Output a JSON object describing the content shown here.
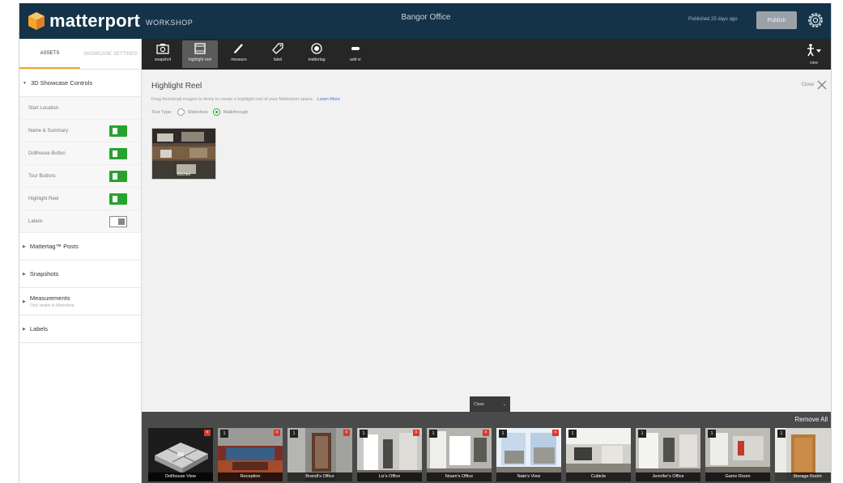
{
  "header": {
    "brand": "matterport",
    "product": "WORKSHOP",
    "space_title": "Bangor Office",
    "published": "Published 25 days ago",
    "publish_label": "Publish",
    "brand_colors": {
      "header_bg": "#143349",
      "toggle_on": "#27a32d",
      "accent": "#f6a623"
    }
  },
  "sidebar": {
    "tabs": [
      {
        "label": "ASSETS"
      },
      {
        "label": "SHOWCASE SETTINGS"
      }
    ],
    "controls_section": "3D Showcase Controls",
    "controls": [
      {
        "label": "Start Location",
        "toggle": null
      },
      {
        "label": "Name & Summary",
        "toggle": "on"
      },
      {
        "label": "Dollhouse Button",
        "toggle": "on"
      },
      {
        "label": "Tour Buttons",
        "toggle": "on"
      },
      {
        "label": "Highlight Reel",
        "toggle": "on"
      },
      {
        "label": "Labels",
        "toggle": "off"
      }
    ],
    "sections": [
      {
        "title": "Mattertag™ Posts",
        "subtitle": ""
      },
      {
        "title": "Snapshots",
        "subtitle": ""
      },
      {
        "title": "Measurements",
        "subtitle": "Only visible in Workshop"
      },
      {
        "title": "Labels",
        "subtitle": ""
      }
    ]
  },
  "toolbar": {
    "tools": [
      {
        "label": "snapshot",
        "icon": "camera-icon"
      },
      {
        "label": "highlight reel",
        "icon": "film-icon"
      },
      {
        "label": "measure",
        "icon": "pencil-icon"
      },
      {
        "label": "label",
        "icon": "tag-icon"
      },
      {
        "label": "mattertag",
        "icon": "target-icon"
      },
      {
        "label": "add vr",
        "icon": "vr-icon"
      }
    ],
    "person_label": "view"
  },
  "panel": {
    "title": "Highlight Reel",
    "description": "Drag thumbnail images to firmly to create a highlight reel of your Matterport space.",
    "learn_more": "Learn More",
    "tour_type_label": "Tour Type:",
    "tour_options": [
      "Slideshow",
      "Walkthrough"
    ],
    "tour_selected": "Walkthrough",
    "close_label": "Close",
    "reel_items": [
      {
        "label": "Kitchen"
      }
    ]
  },
  "dock": {
    "tab_label": "Close",
    "remove_all": "Remove All",
    "snapshots": [
      {
        "label": "Dollhouse View",
        "num": ""
      },
      {
        "label": "Reception",
        "num": "1"
      },
      {
        "label": "Brandi's Office",
        "num": "1"
      },
      {
        "label": "Liz's Office",
        "num": "1"
      },
      {
        "label": "Noam's Office",
        "num": "1"
      },
      {
        "label": "Nate's View",
        "num": "1"
      },
      {
        "label": "Cubicle",
        "num": "1"
      },
      {
        "label": "Jennifer's Office",
        "num": "1"
      },
      {
        "label": "Game Room",
        "num": "1"
      },
      {
        "label": "Storage Room",
        "num": "1"
      }
    ]
  }
}
